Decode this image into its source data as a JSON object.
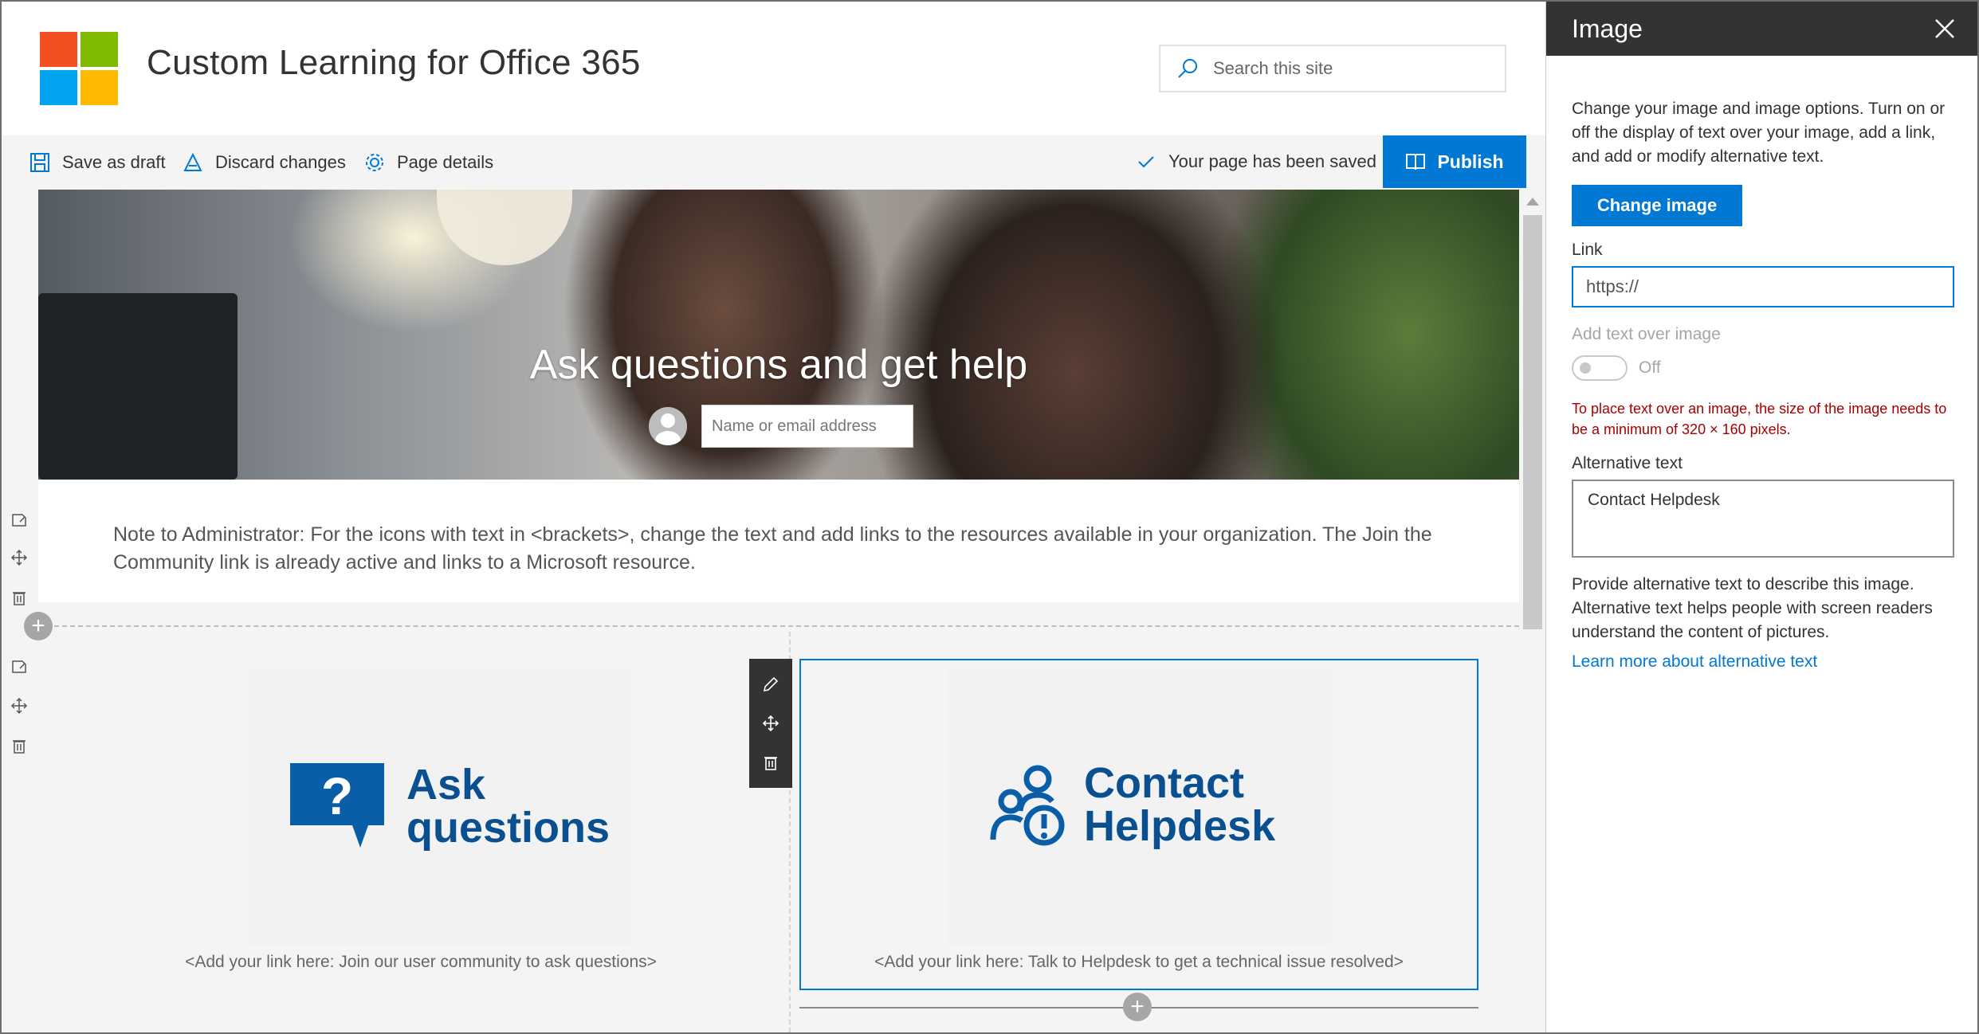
{
  "site": {
    "title": "Custom Learning for Office 365",
    "search_placeholder": "Search this site"
  },
  "commandbar": {
    "save_draft": "Save as draft",
    "discard": "Discard changes",
    "page_details": "Page details",
    "status": "Your page has been saved",
    "publish": "Publish"
  },
  "hero": {
    "title": "Ask questions and get help",
    "people_placeholder": "Name or email address"
  },
  "note": "Note to Administrator: For the icons with text in <brackets>, change the text and add links to the resources available in your organization. The Join the Community link is already active and links to a Microsoft resource.",
  "tiles": [
    {
      "line1": "Ask",
      "line2": "questions",
      "caption": "<Add your link here: Join our user community to ask questions>"
    },
    {
      "line1": "Contact",
      "line2": "Helpdesk",
      "caption": "<Add your link here: Talk to Helpdesk to get a technical issue resolved>"
    }
  ],
  "pane": {
    "title": "Image",
    "description": "Change your image and image options. Turn on or off the display of text over your image, add a link, and add or modify alternative text.",
    "change_image": "Change image",
    "link_label": "Link",
    "link_value": "https://",
    "text_over_label": "Add text over image",
    "toggle_state": "Off",
    "error": "To place text over an image, the size of the image needs to be a minimum of 320 × 160 pixels.",
    "alt_label": "Alternative text",
    "alt_value": "Contact Helpdesk",
    "help": "Provide alternative text to describe this image. Alternative text helps people with screen readers understand the content of pictures.",
    "learn_more": "Learn more about alternative text"
  },
  "colors": {
    "accent": "#0078d4",
    "logo_blue": "#0a4f8f",
    "error": "#a80000",
    "pane_header": "#333333"
  },
  "icons": [
    "search-icon",
    "save-icon",
    "discard-icon",
    "gear-icon",
    "checkmark-icon",
    "publish-book-icon",
    "close-icon",
    "edit-icon",
    "move-icon",
    "delete-icon",
    "add-icon",
    "person-icon",
    "question-bubble-icon",
    "helpdesk-people-icon"
  ]
}
